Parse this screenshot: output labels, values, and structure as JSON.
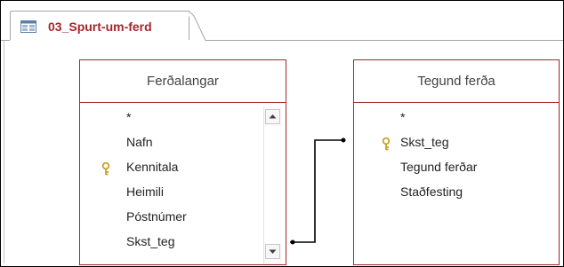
{
  "document_tab": {
    "title": "03_Spurt-um-ferd",
    "icon": "query-design-icon"
  },
  "tables": [
    {
      "title": "Ferðalangar",
      "fields": [
        {
          "label": "*",
          "primary_key": false
        },
        {
          "label": "Nafn",
          "primary_key": false
        },
        {
          "label": "Kennitala",
          "primary_key": true
        },
        {
          "label": "Heimili",
          "primary_key": false
        },
        {
          "label": "Póstnúmer",
          "primary_key": false
        },
        {
          "label": "Skst_teg",
          "primary_key": false
        }
      ],
      "has_scrollbar": true
    },
    {
      "title": "Tegund ferða",
      "fields": [
        {
          "label": "*",
          "primary_key": false
        },
        {
          "label": "Skst_teg",
          "primary_key": true
        },
        {
          "label": "Tegund ferðar",
          "primary_key": false
        },
        {
          "label": "Staðfesting",
          "primary_key": false
        }
      ],
      "has_scrollbar": false
    }
  ],
  "relationship": {
    "from_field": "Skst_teg",
    "to_field": "Skst_teg"
  },
  "colors": {
    "accent": "#a4262c",
    "key_icon": "#c9a227",
    "line": "#000000"
  }
}
